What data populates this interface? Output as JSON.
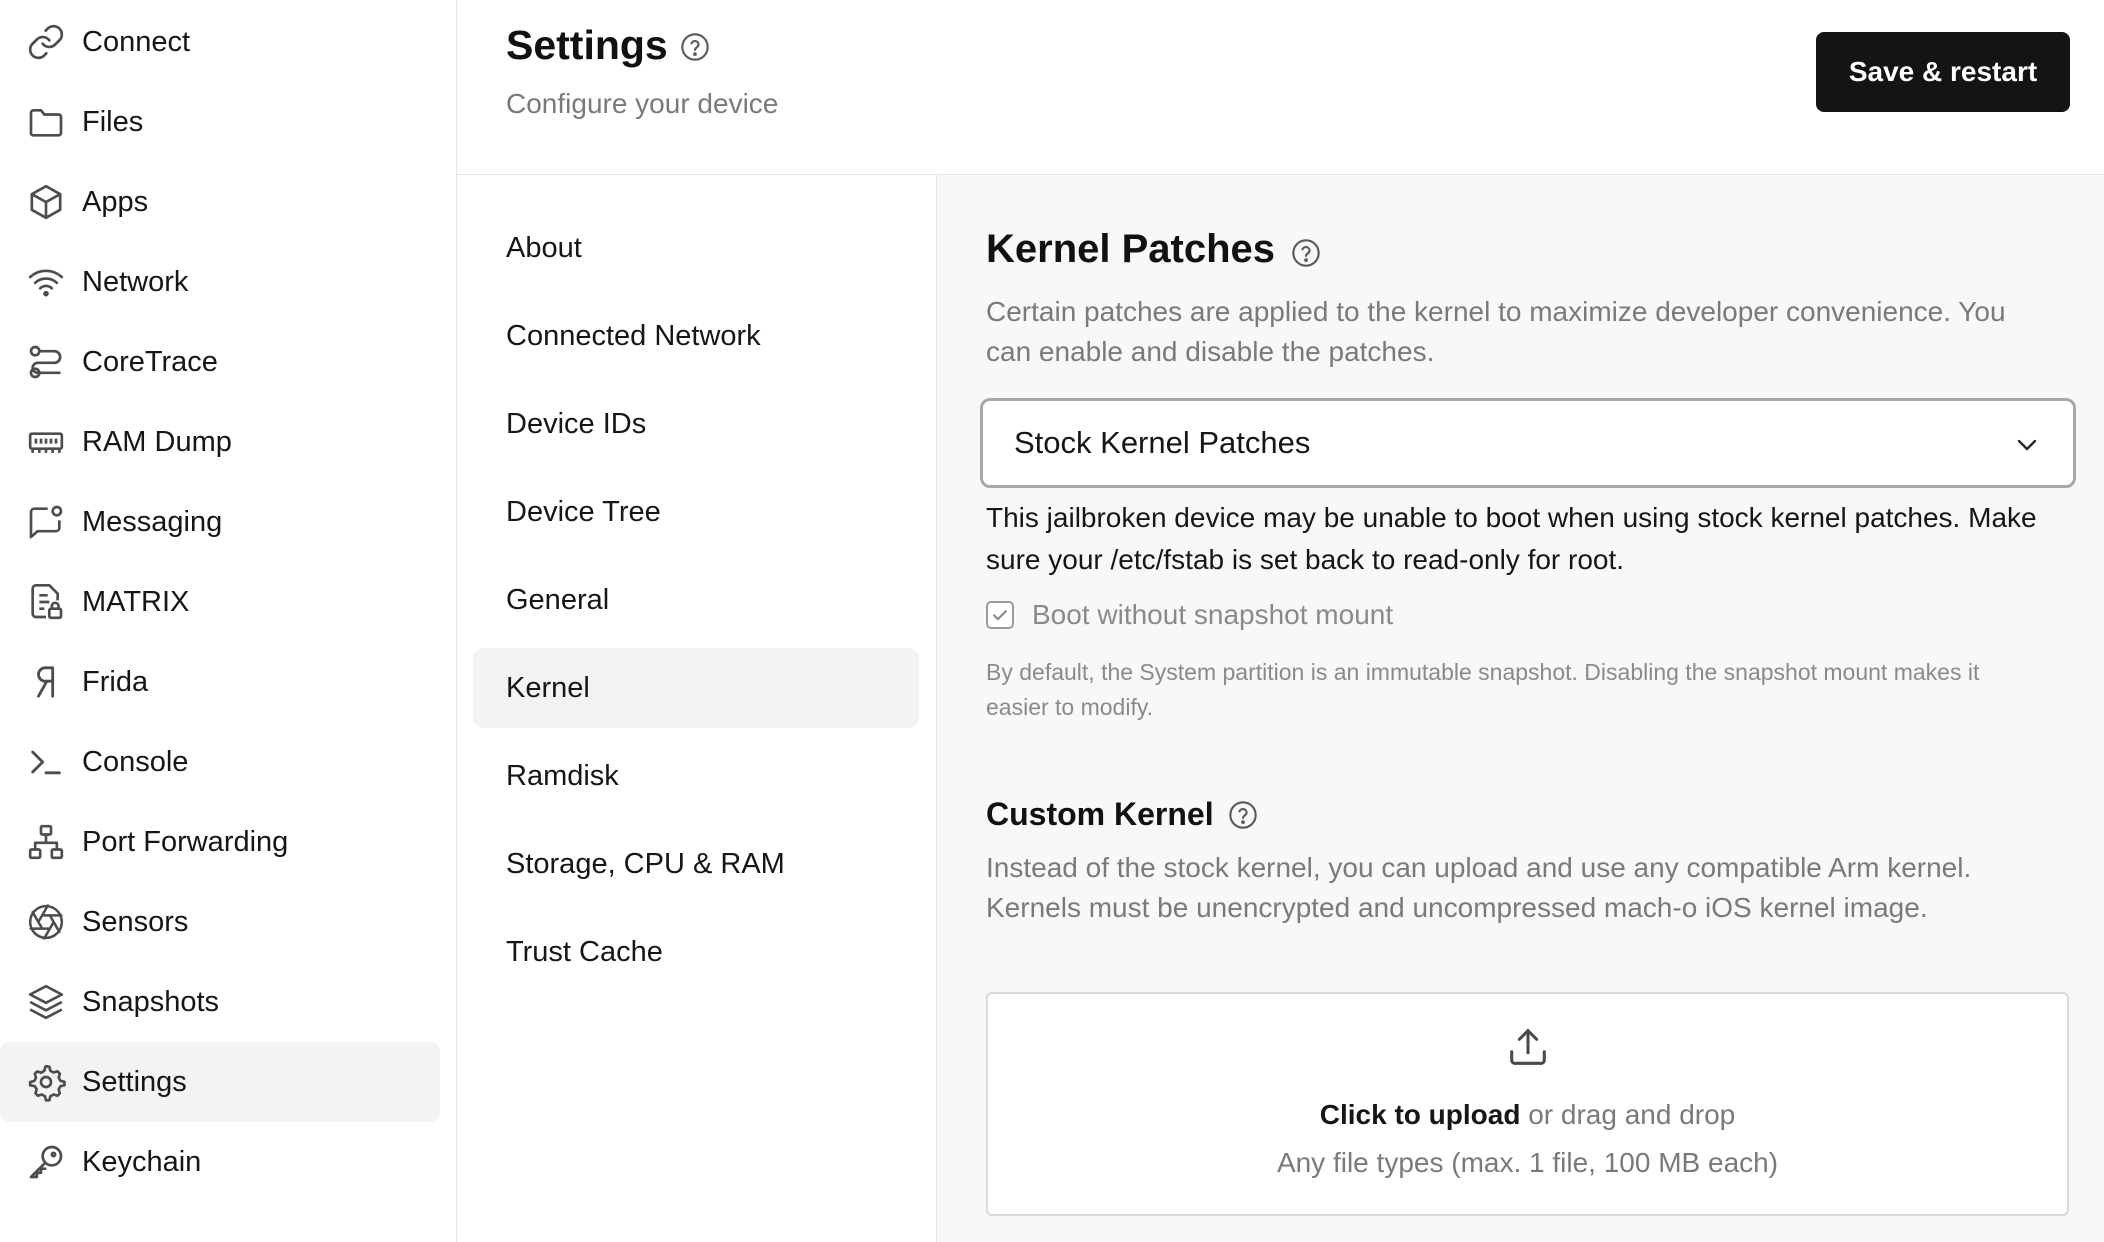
{
  "sidebar": {
    "items": [
      {
        "label": "Connect",
        "icon": "link-icon"
      },
      {
        "label": "Files",
        "icon": "folder-icon"
      },
      {
        "label": "Apps",
        "icon": "cube-icon"
      },
      {
        "label": "Network",
        "icon": "wifi-icon"
      },
      {
        "label": "CoreTrace",
        "icon": "route-icon"
      },
      {
        "label": "RAM Dump",
        "icon": "memory-icon"
      },
      {
        "label": "Messaging",
        "icon": "message-icon"
      },
      {
        "label": "MATRIX",
        "icon": "file-lock-icon"
      },
      {
        "label": "Frida",
        "icon": "frida-icon"
      },
      {
        "label": "Console",
        "icon": "terminal-icon"
      },
      {
        "label": "Port Forwarding",
        "icon": "network-tree-icon"
      },
      {
        "label": "Sensors",
        "icon": "aperture-icon"
      },
      {
        "label": "Snapshots",
        "icon": "layers-icon"
      },
      {
        "label": "Settings",
        "icon": "gear-icon"
      },
      {
        "label": "Keychain",
        "icon": "key-icon"
      }
    ],
    "active": "Settings"
  },
  "header": {
    "title": "Settings",
    "subtitle": "Configure your device",
    "save_label": "Save & restart"
  },
  "settings_nav": {
    "items": [
      "About",
      "Connected Network",
      "Device IDs",
      "Device Tree",
      "General",
      "Kernel",
      "Ramdisk",
      "Storage, CPU & RAM",
      "Trust Cache"
    ],
    "active": "Kernel"
  },
  "kernel_patches": {
    "title": "Kernel Patches",
    "description": "Certain patches are applied to the kernel to maximize developer convenience. You can enable and disable the patches.",
    "select_value": "Stock Kernel Patches",
    "warning": "This jailbroken device may be unable to boot when using stock kernel patches. Make sure your /etc/fstab is set back to read-only for root.",
    "checkbox_label": "Boot without snapshot mount",
    "checkbox_checked": true,
    "note": "By default, the System partition is an immutable snapshot. Disabling the snapshot mount makes it easier to modify."
  },
  "custom_kernel": {
    "title": "Custom Kernel",
    "description": "Instead of the stock kernel, you can upload and use any compatible Arm kernel. Kernels must be unencrypted and uncompressed mach-o iOS kernel image.",
    "upload_strong": "Click to upload",
    "upload_rest": " or drag and drop",
    "upload_hint": "Any file types (max. 1 file, 100 MB each)"
  }
}
